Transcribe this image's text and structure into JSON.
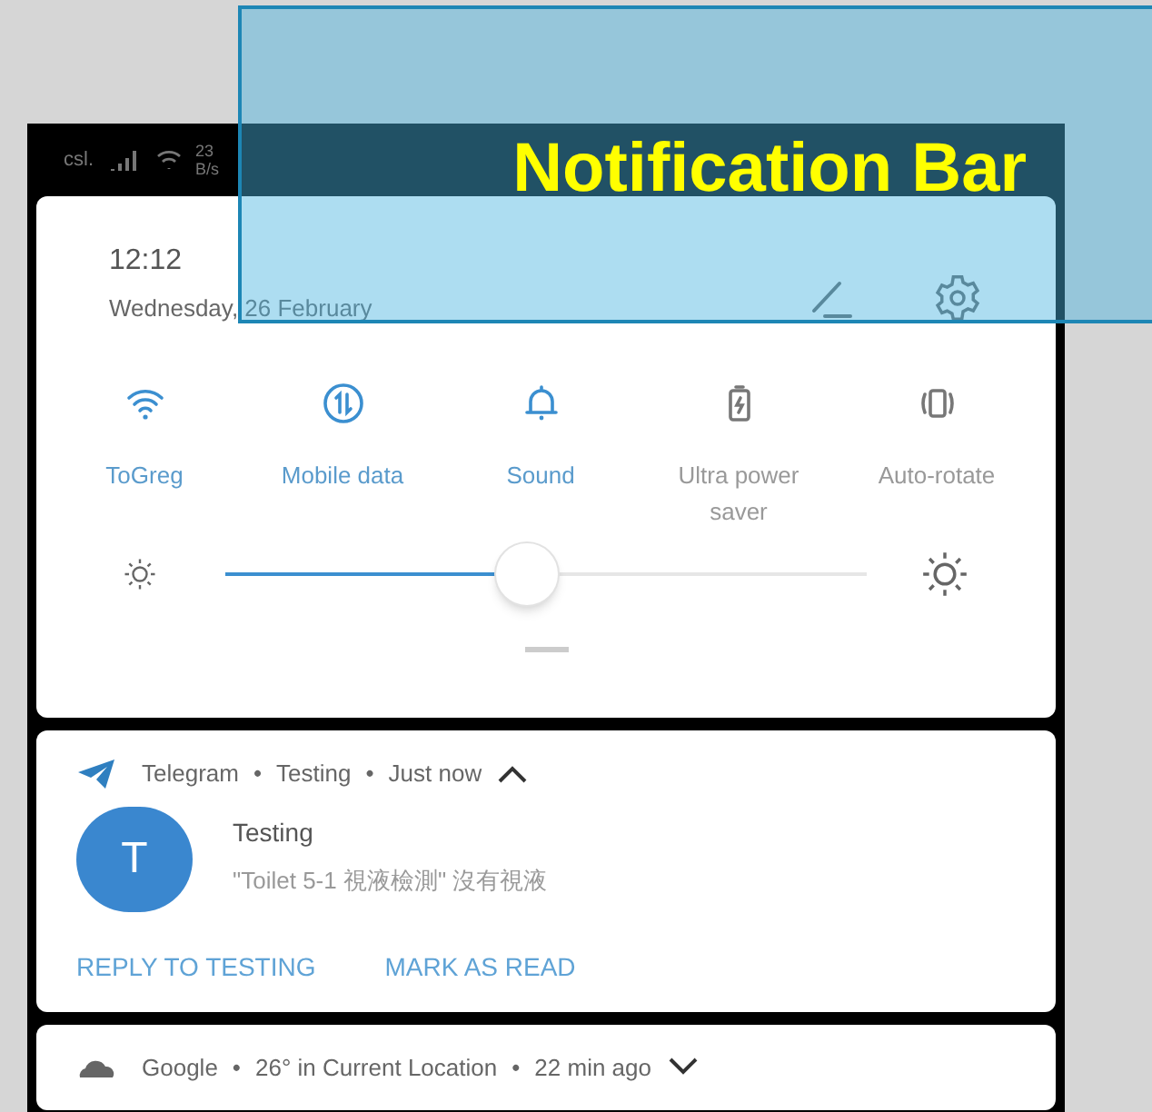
{
  "callout": {
    "label": "Notification Bar"
  },
  "status_bar": {
    "carrier": "csl.",
    "speed_value": "23",
    "speed_unit": "B/s"
  },
  "header": {
    "time": "12:12",
    "date": "Wednesday, 26 February"
  },
  "quick_tiles": [
    {
      "kind": "wifi",
      "label": "ToGreg",
      "on": true
    },
    {
      "kind": "data",
      "label": "Mobile data",
      "on": true
    },
    {
      "kind": "sound",
      "label": "Sound",
      "on": true
    },
    {
      "kind": "battery",
      "label": "Ultra power saver",
      "on": false
    },
    {
      "kind": "rotate",
      "label": "Auto-rotate",
      "on": false
    }
  ],
  "brightness": {
    "level": 0.47
  },
  "notifications": [
    {
      "kind": "message",
      "app": "Telegram",
      "sep1": "•",
      "subject": "Testing",
      "sep2": "•",
      "time": "Just now",
      "expanded": true,
      "avatar_letter": "T",
      "title": "Testing",
      "text": "\"Toilet 5-1 視液檢測\" 沒有視液",
      "actions": [
        "REPLY TO TESTING",
        "MARK AS READ"
      ]
    },
    {
      "kind": "weather",
      "app": "Google",
      "sep1": "•",
      "subject": "26° in Current Location",
      "sep2": "•",
      "time": "22 min ago",
      "expanded": false
    }
  ]
}
